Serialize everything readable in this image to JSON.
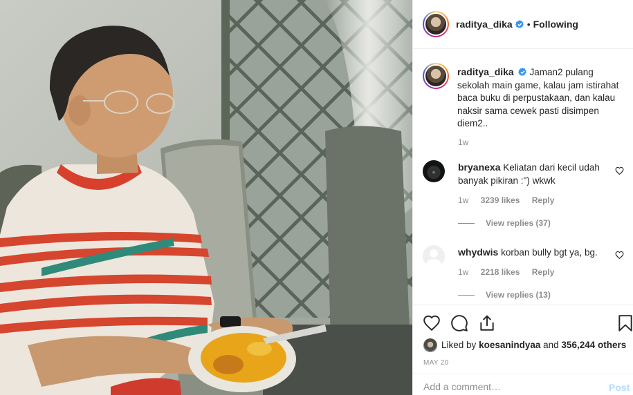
{
  "header": {
    "username": "raditya_dika",
    "separator": "•",
    "follow_status": "Following"
  },
  "caption": {
    "username": "raditya_dika",
    "text": "Jaman2 pulang sekolah main game, kalau jam istirahat baca buku di perpustakaan, dan kalau naksir sama cewek pasti disimpen diem2..",
    "age": "1w"
  },
  "comments": [
    {
      "username": "bryanexa",
      "text": "Keliatan dari kecil udah banyak pikiran :\") wkwk",
      "age": "1w",
      "likes": "3239 likes",
      "reply_label": "Reply",
      "view_replies": "View replies (37)"
    },
    {
      "username": "whydwis",
      "text": "korban bully bgt ya, bg.",
      "age": "1w",
      "likes": "2218 likes",
      "reply_label": "Reply",
      "view_replies": "View replies (13)"
    }
  ],
  "likes": {
    "prefix": "Liked by",
    "user": "koesanindyaa",
    "connector": "and",
    "others": "356,244 others"
  },
  "date": "MAY 20",
  "add_comment": {
    "placeholder": "Add a comment…",
    "post_label": "Post"
  },
  "icons": {
    "verified": "verified-badge-icon",
    "like": "heart-icon",
    "comment": "speech-bubble-icon",
    "share": "share-icon",
    "save": "bookmark-icon"
  },
  "colors": {
    "verified_blue": "#3897f0",
    "text": "#262626",
    "muted": "#8e8e8e",
    "post_disabled": "#b3dbff"
  }
}
